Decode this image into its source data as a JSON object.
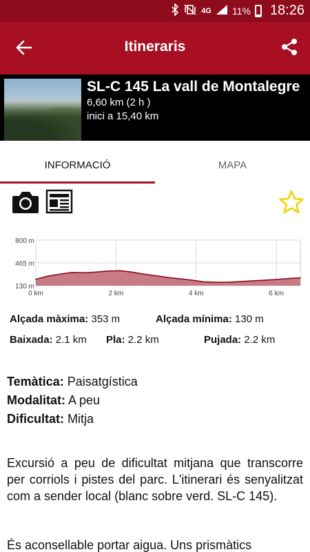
{
  "status_bar": {
    "time": "18:26",
    "network": "4G",
    "battery": "11%"
  },
  "app_bar": {
    "title": "Itineraris"
  },
  "route": {
    "name": "SL-C 145 La vall de Montalegre",
    "distance": "6,60 km (2 h )",
    "start": "inici a 15,40 km"
  },
  "tabs": [
    {
      "label": "INFORMACIÓ",
      "active": true
    },
    {
      "label": "MAPA",
      "active": false
    }
  ],
  "chart_data": {
    "type": "area",
    "title": "",
    "xlabel": "",
    "ylabel": "",
    "x": [
      0,
      0.3,
      0.6,
      0.9,
      1.2,
      1.5,
      1.8,
      2.1,
      2.4,
      2.7,
      3.0,
      3.3,
      3.6,
      3.9,
      4.2,
      4.5,
      4.8,
      5.1,
      5.4,
      5.7,
      6.0,
      6.3,
      6.6
    ],
    "series": [
      {
        "values": [
          225,
          270,
          300,
          325,
          320,
          330,
          345,
          350,
          330,
          300,
          275,
          250,
          230,
          210,
          185,
          180,
          180,
          190,
          200,
          210,
          220,
          235,
          245
        ]
      }
    ],
    "ylim": [
      130,
      800
    ],
    "xlim": [
      0,
      6.6
    ],
    "y_ticks": [
      {
        "value": 800,
        "label": "800 m"
      },
      {
        "value": 465,
        "label": "465 m"
      },
      {
        "value": 130,
        "label": "130 m"
      }
    ],
    "x_ticks": [
      {
        "value": 0,
        "label": "0 km"
      },
      {
        "value": 2,
        "label": "2 km"
      },
      {
        "value": 4,
        "label": "4 km"
      },
      {
        "value": 6,
        "label": "6 km"
      }
    ],
    "grid": true,
    "colors": {
      "fill": "#c87b85",
      "line": "#8e0c1c"
    }
  },
  "stats": {
    "alt_max_label": "Alçada màxima:",
    "alt_max_value": " 353 m",
    "alt_min_label": "Alçada mínima:",
    "alt_min_value": " 130 m",
    "baixada_label": "Baixada:",
    "baixada_value": " 2.1 km",
    "pla_label": "Pla:",
    "pla_value": " 2.2 km",
    "pujada_label": "Pujada:",
    "pujada_value": " 2.2 km"
  },
  "info": {
    "tematica_label": "Temàtica:",
    "tematica_value": " Paisatgística",
    "modalitat_label": "Modalitat:",
    "modalitat_value": " A peu",
    "dificultat_label": "Dificultat:",
    "dificultat_value": " Mitja"
  },
  "description": [
    "Excursió a peu de dificultat mitjana que transcorre per corriols i pistes del parc. L'itinerari és senyalitzat com a sender local (blanc sobre verd. SL-C 145).",
    "És aconsellable portar aigua. Uns prismàtics"
  ],
  "icons": {
    "back": "arrow-back-icon",
    "share": "share-icon",
    "camera": "camera-icon",
    "document": "document-icon",
    "favorite": "star-outline-icon"
  },
  "colors": {
    "primary": "#a80f23",
    "primary_dark": "#8e0c1c",
    "star": "#f2d500"
  }
}
